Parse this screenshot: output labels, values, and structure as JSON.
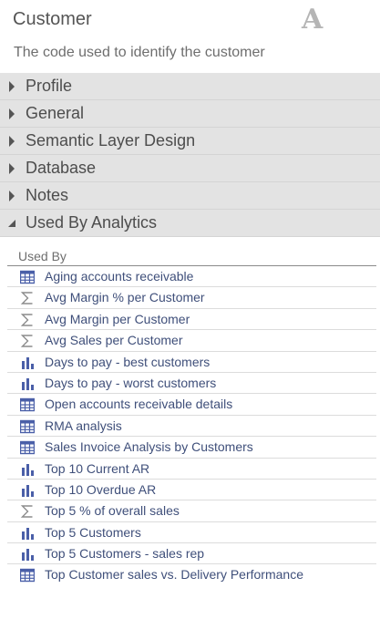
{
  "header": {
    "title": "Customer",
    "type_icon": "attribute-A-icon",
    "type_glyph": "A",
    "description": "The code used to identify the customer"
  },
  "sections": [
    {
      "label": "Profile",
      "expanded": false
    },
    {
      "label": "General",
      "expanded": false
    },
    {
      "label": "Semantic Layer Design",
      "expanded": false
    },
    {
      "label": "Database",
      "expanded": false
    },
    {
      "label": "Notes",
      "expanded": false
    },
    {
      "label": "Used By Analytics",
      "expanded": true
    }
  ],
  "used_by": {
    "header": "Used By",
    "items": [
      {
        "label": "Aging accounts receivable",
        "icon": "grid-report-icon"
      },
      {
        "label": "Avg Margin % per Customer",
        "icon": "sigma-metric-icon"
      },
      {
        "label": "Avg Margin per Customer",
        "icon": "sigma-metric-icon"
      },
      {
        "label": "Avg Sales per Customer",
        "icon": "sigma-metric-icon"
      },
      {
        "label": "Days to pay - best customers",
        "icon": "bar-chart-icon"
      },
      {
        "label": "Days to pay - worst customers",
        "icon": "bar-chart-icon"
      },
      {
        "label": "Open accounts receivable details",
        "icon": "grid-report-icon"
      },
      {
        "label": "RMA analysis",
        "icon": "grid-report-icon"
      },
      {
        "label": "Sales Invoice Analysis by Customers",
        "icon": "grid-report-icon"
      },
      {
        "label": "Top 10 Current AR",
        "icon": "bar-chart-icon"
      },
      {
        "label": "Top 10 Overdue AR",
        "icon": "bar-chart-icon"
      },
      {
        "label": "Top 5 % of overall sales",
        "icon": "sigma-metric-icon"
      },
      {
        "label": "Top 5 Customers",
        "icon": "bar-chart-icon"
      },
      {
        "label": "Top 5 Customers - sales rep",
        "icon": "bar-chart-icon"
      },
      {
        "label": "Top Customer sales vs. Delivery Performance",
        "icon": "grid-report-icon"
      }
    ]
  },
  "colors": {
    "section_bg": "#e3e3e3",
    "link_text": "#3f4f7a",
    "icon_blue": "#4a5fa8",
    "icon_gray": "#8c8c8c"
  }
}
